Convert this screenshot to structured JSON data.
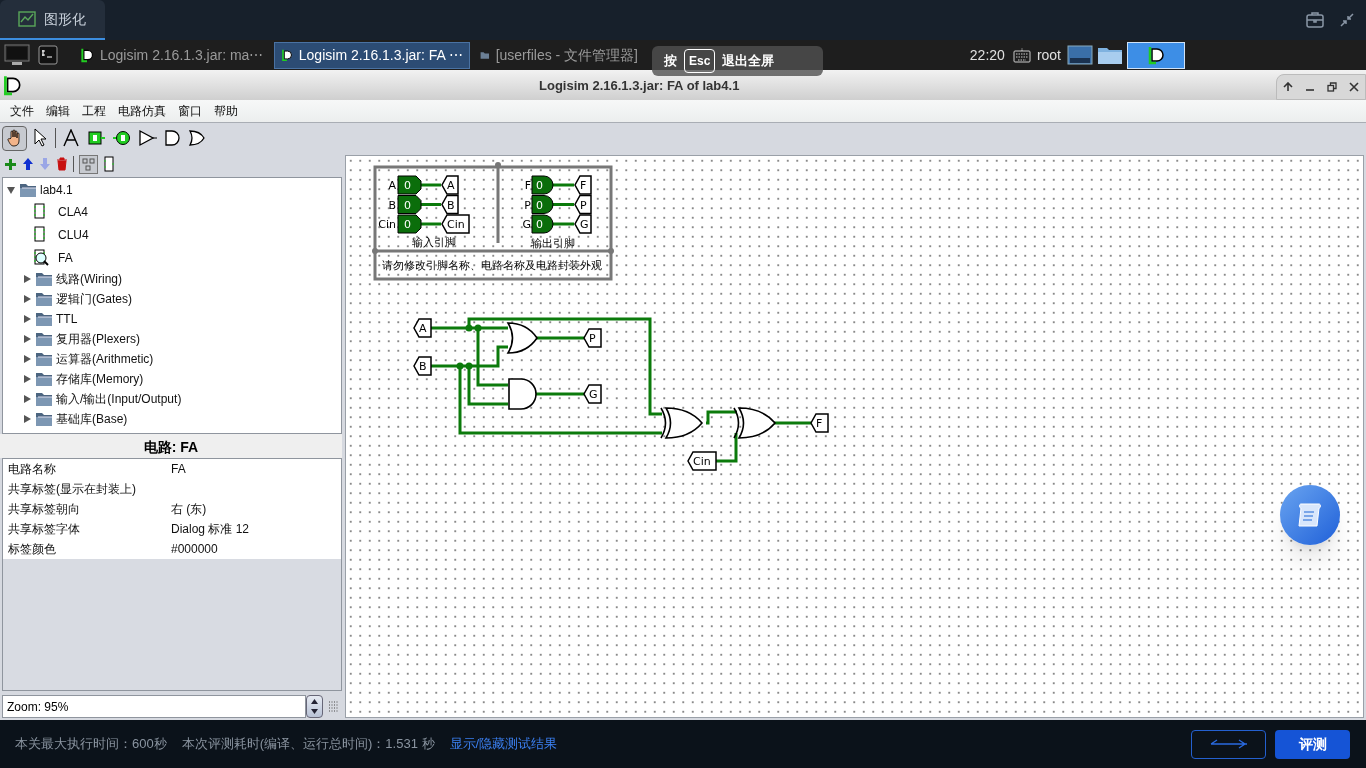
{
  "desktop_tab": {
    "label": "图形化",
    "selected": true
  },
  "taskbar": {
    "tasks": [
      {
        "kind": "logisim",
        "label": "Logisim 2.16.1.3.jar: ma⋯",
        "selected": false
      },
      {
        "kind": "logisim",
        "label": "Logisim 2.16.1.3.jar: FA ⋯",
        "selected": true
      },
      {
        "kind": "files",
        "label": "[userfiles - 文件管理器]",
        "selected": false
      }
    ],
    "clock": "22:20",
    "user": "root"
  },
  "fullscreen_hint": {
    "before": "按",
    "key": "Esc",
    "after": "退出全屏"
  },
  "window": {
    "title": "Logisim 2.16.1.3.jar: FA of lab4.1"
  },
  "menu": [
    "文件",
    "编辑",
    "工程",
    "电路仿真",
    "窗口",
    "帮助"
  ],
  "explorer": {
    "items": [
      {
        "label": "lab4.1",
        "kind": "project",
        "expanded": true,
        "children": [
          {
            "label": "CLA4",
            "kind": "circuit",
            "current": false
          },
          {
            "label": "CLU4",
            "kind": "circuit",
            "current": false
          },
          {
            "label": "FA",
            "kind": "circuit",
            "current": true
          }
        ]
      },
      {
        "label": "线路(Wiring)",
        "kind": "library",
        "expanded": false
      },
      {
        "label": "逻辑门(Gates)",
        "kind": "library",
        "expanded": false
      },
      {
        "label": "TTL",
        "kind": "library",
        "expanded": false
      },
      {
        "label": "复用器(Plexers)",
        "kind": "library",
        "expanded": false
      },
      {
        "label": "运算器(Arithmetic)",
        "kind": "library",
        "expanded": false
      },
      {
        "label": "存储库(Memory)",
        "kind": "library",
        "expanded": false
      },
      {
        "label": "输入/输出(Input/Output)",
        "kind": "library",
        "expanded": false
      },
      {
        "label": "基础库(Base)",
        "kind": "library",
        "expanded": false
      }
    ]
  },
  "properties": {
    "title": "电路: FA",
    "rows": [
      {
        "name": "电路名称",
        "value": "FA"
      },
      {
        "name": "共享标签(显示在封装上)"
      },
      {
        "name": "共享标签朝向",
        "value": "右 (东)"
      },
      {
        "name": "共享标签字体",
        "value": "Dialog 标准 12"
      },
      {
        "name": "标签颜色",
        "value": "#000000"
      }
    ]
  },
  "zoom": "Zoom: 95%",
  "circuit": {
    "appearance": {
      "inputs": [
        {
          "label": "A",
          "value": "0",
          "tunnel": "A"
        },
        {
          "label": "B",
          "value": "0",
          "tunnel": "B"
        },
        {
          "label": "Cin",
          "value": "0",
          "tunnel": "Cin"
        }
      ],
      "outputs": [
        {
          "label": "F",
          "value": "0",
          "tunnel": "F"
        },
        {
          "label": "P",
          "value": "0",
          "tunnel": "P"
        },
        {
          "label": "G",
          "value": "0",
          "tunnel": "G"
        }
      ],
      "input_caption": "输入引脚",
      "output_caption": "输出引脚",
      "note": "请勿修改引脚名称、电路名称及电路封装外观"
    },
    "tunnels": [
      "A",
      "B",
      "P",
      "G",
      "Cin",
      "F"
    ]
  },
  "footer": {
    "max_time": "本关最大执行时间：600秒",
    "elapsed": "本次评测耗时(编译、运行总时间)：1.531 秒",
    "toggle_link": "显示/隐藏测试结果",
    "evaluate_button": "评测"
  }
}
